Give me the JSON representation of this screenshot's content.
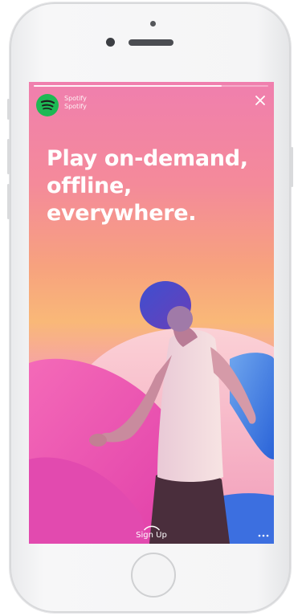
{
  "story": {
    "progress": 0.8,
    "account_line_1": "Spotify",
    "account_line_2": "Spotify",
    "headline_line_1": "Play on-demand,",
    "headline_line_2": "offline,",
    "headline_line_3": "everywhere.",
    "cta_label": "Sign Up"
  },
  "icons": {
    "brand": "spotify-logo-icon",
    "close": "close-icon",
    "cta": "chevron-up-icon",
    "more": "more-icon"
  },
  "colors": {
    "brand_green": "#1db954",
    "text": "#ffffff",
    "background_top": "#f07fae",
    "background_mid": "#f9b878",
    "background_bottom": "#e85cb7"
  }
}
